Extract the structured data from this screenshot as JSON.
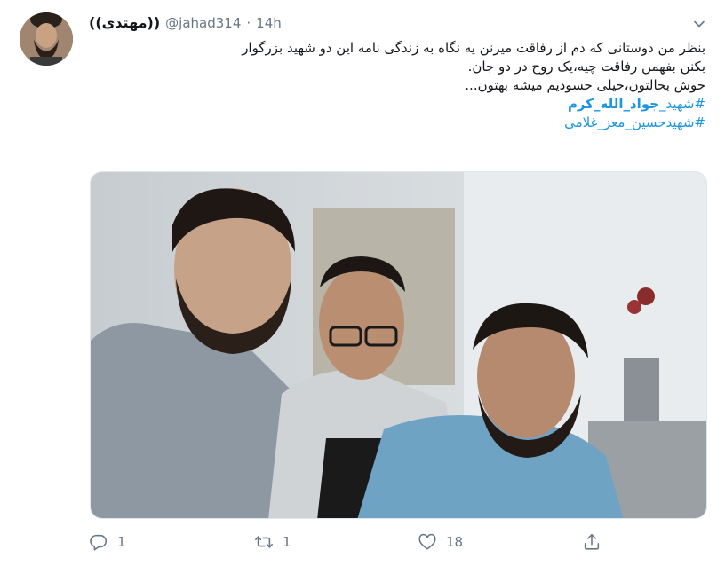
{
  "tweet": {
    "display_name": "((مهتدی))",
    "handle": "@jahad314",
    "separator": "·",
    "time": "14h",
    "text_lines": [
      "بنظر من دوستانی که دم از رفاقت میزنن یه نگاه به زندگی نامه این دو شهید بزرگوار",
      "بکنن بفهمن رفاقت چیه،یک روح در دو جان.",
      "خوش بحالتون،خیلی حسودیم میشه بهتون..."
    ],
    "hashtag_1_prefix": "#شهید_",
    "hashtag_1_bold": "جواد_الله_کرم",
    "hashtag_2": "#شهیدحسین_معز_غلامی"
  },
  "actions": {
    "reply_count": "1",
    "retweet_count": "1",
    "like_count": "18"
  },
  "icons": {
    "reply": "reply-icon",
    "retweet": "retweet-icon",
    "like": "heart-icon",
    "share": "share-icon",
    "menu": "chevron-down-icon"
  },
  "colors": {
    "link": "#1b95e0",
    "secondary_text": "#657786",
    "primary_text": "#14171a"
  }
}
